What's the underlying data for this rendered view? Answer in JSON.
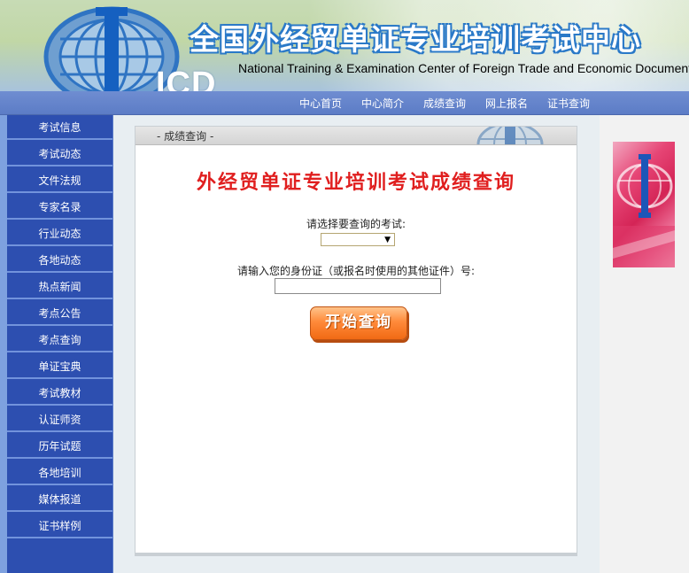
{
  "header": {
    "logo_text": "ICD",
    "title": "全国外经贸单证专业培训考试中心",
    "subtitle": "National Training & Examination Center of Foreign Trade and Economic Documents"
  },
  "nav": {
    "items": [
      "中心首页",
      "中心简介",
      "成绩查询",
      "网上报名",
      "证书查询"
    ]
  },
  "sidebar": {
    "items": [
      "考试信息",
      "考试动态",
      "文件法规",
      "专家名录",
      "行业动态",
      "各地动态",
      "热点新闻",
      "考点公告",
      "考点查询",
      "单证宝典",
      "考试教材",
      "认证师资",
      "历年试题",
      "各地培训",
      "媒体报道",
      "证书样例"
    ]
  },
  "panel": {
    "section_title": "- 成绩查询 -",
    "heading": "外经贸单证专业培训考试成绩查询",
    "exam_label": "请选择要查询的考试:",
    "exam_selected": "",
    "id_label": "请输入您的身份证（或报名时使用的其他证件）号:",
    "id_value": "",
    "submit_label": "开始查询"
  },
  "colors": {
    "nav_blue": "#5c7cc6",
    "sidebar_blue": "#2d4fb0",
    "heading_red": "#e01f1f",
    "button_orange": "#f16a14"
  }
}
